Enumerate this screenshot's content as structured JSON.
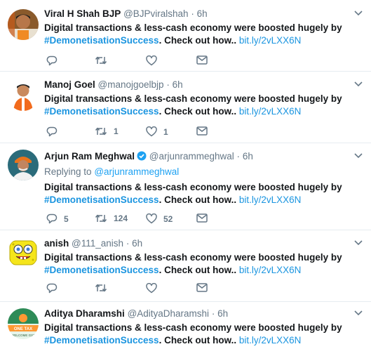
{
  "tweets": [
    {
      "name": "Viral H Shah BJP",
      "handle": "@BJPviralshah",
      "dot": "·",
      "time": "6h",
      "text_a": "Digital transactions & less-cash economy were boosted hugely by",
      "hashtag": "#DemonetisationSuccess",
      "text_b": ". Check out how..",
      "link": "bit.ly/2vLXX6N",
      "reply_count": "",
      "retweet_count": "",
      "like_count": ""
    },
    {
      "name": "Manoj Goel",
      "handle": "@manojgoelbjp",
      "dot": "·",
      "time": "6h",
      "text_a": "Digital transactions & less-cash economy were boosted hugely by",
      "hashtag": "#DemonetisationSuccess",
      "text_b": ". Check out how..",
      "link": "bit.ly/2vLXX6N",
      "reply_count": "",
      "retweet_count": "1",
      "like_count": "1"
    },
    {
      "name": "Arjun Ram Meghwal",
      "verified": true,
      "handle": "@arjunrammeghwal",
      "dot": "·",
      "time": "6h",
      "replying_label": "Replying to",
      "replying_handle": "@arjunrammeghwal",
      "text_a": "Digital transactions & less-cash economy were boosted hugely by",
      "hashtag": "#DemonetisationSuccess",
      "text_b": ". Check out how..",
      "link": "bit.ly/2vLXX6N",
      "reply_count": "5",
      "retweet_count": "124",
      "like_count": "52"
    },
    {
      "name": "anish",
      "handle": "@111_anish",
      "dot": "·",
      "time": "6h",
      "text_a": "Digital transactions & less-cash economy were boosted hugely by",
      "hashtag": "#DemonetisationSuccess",
      "text_b": ". Check out how..",
      "link": "bit.ly/2vLXX6N",
      "reply_count": "",
      "retweet_count": "",
      "like_count": ""
    },
    {
      "name": "Aditya Dharamshi",
      "handle": "@AdityaDharamshi",
      "dot": "·",
      "time": "6h",
      "text_a": "Digital transactions & less-cash economy were boosted hugely by",
      "hashtag": "#DemonetisationSuccess",
      "text_b": ". Check out how..",
      "link": "bit.ly/2vLXX6N",
      "avatar_text_1": "ONE TAX",
      "avatar_text_2": "WELCOME GST"
    }
  ],
  "icons": {
    "reply": "reply-icon",
    "retweet": "retweet-icon",
    "like": "heart-icon",
    "message": "envelope-icon",
    "more": "chevron-down-icon",
    "verified": "verified-badge-icon"
  },
  "colors": {
    "link": "#1b95e0",
    "muted": "#657786",
    "text": "#14171a",
    "divider": "#e6ecf0",
    "verified": "#1da1f2"
  }
}
